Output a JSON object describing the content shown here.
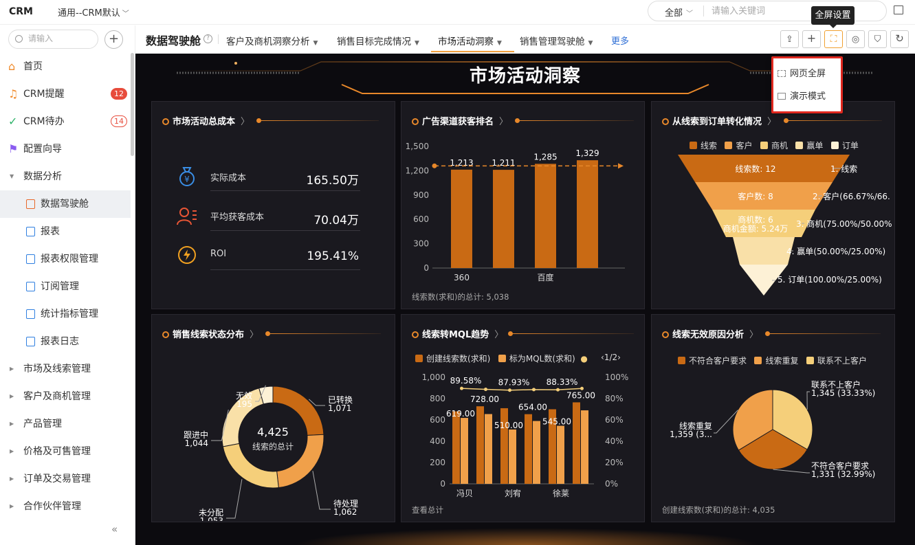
{
  "topbar": {
    "logo": "CRM",
    "app": "通用--CRM默认",
    "search_scope": "全部",
    "search_placeholder": "请输入关键词"
  },
  "sidebar": {
    "search_placeholder": "请输入",
    "items": [
      {
        "label": "首页",
        "icon": "home-icon"
      },
      {
        "label": "CRM提醒",
        "icon": "bell-icon",
        "badge": "12"
      },
      {
        "label": "CRM待办",
        "icon": "check-circle-icon",
        "badge": "14"
      },
      {
        "label": "配置向导",
        "icon": "flag-icon"
      },
      {
        "label": "数据分析",
        "icon": "caret-down-icon"
      },
      {
        "label": "数据驾驶舱",
        "icon": "cockpit-icon"
      },
      {
        "label": "报表",
        "icon": "report-icon"
      },
      {
        "label": "报表权限管理",
        "icon": "report-permission-icon"
      },
      {
        "label": "订阅管理",
        "icon": "subscribe-icon"
      },
      {
        "label": "统计指标管理",
        "icon": "metric-icon"
      },
      {
        "label": "报表日志",
        "icon": "log-icon"
      },
      {
        "label": "市场及线索管理",
        "icon": "caret-right-icon"
      },
      {
        "label": "客户及商机管理",
        "icon": "caret-right-icon"
      },
      {
        "label": "产品管理",
        "icon": "caret-right-icon"
      },
      {
        "label": "价格及可售管理",
        "icon": "caret-right-icon"
      },
      {
        "label": "订单及交易管理",
        "icon": "caret-right-icon"
      },
      {
        "label": "合作伙伴管理",
        "icon": "caret-right-icon"
      }
    ],
    "collapse": "«"
  },
  "tabbar": {
    "title": "数据驾驶舱",
    "tabs": [
      {
        "label": "客户及商机洞察分析"
      },
      {
        "label": "销售目标完成情况"
      },
      {
        "label": "市场活动洞察"
      },
      {
        "label": "销售管理驾驶舱"
      }
    ],
    "more": "更多",
    "tooltip": "全屏设置",
    "menu": [
      "网页全屏",
      "演示模式"
    ]
  },
  "dashboard": {
    "title": "市场活动洞察",
    "colors": {
      "c1": "#c96a14",
      "c2": "#f0a04a",
      "c3": "#f5cf7a",
      "c4": "#f9e0a8",
      "c5": "#fdf1d6"
    },
    "p1": {
      "title": "市场活动总成本",
      "kpis": [
        {
          "label": "实际成本",
          "value": "165.50万",
          "icon": "money-bag-icon"
        },
        {
          "label": "平均获客成本",
          "value": "70.04万",
          "icon": "user-list-icon"
        },
        {
          "label": "ROI",
          "value": "195.41%",
          "icon": "lightning-icon"
        }
      ]
    },
    "p2": {
      "title": "广告渠道获客排名",
      "footer": "线索数(求和)的总计: 5,038"
    },
    "p3": {
      "title": "从线索到订单转化情况",
      "legend": [
        "线索",
        "客户",
        "商机",
        "赢单",
        "订单"
      ],
      "inner": [
        "线索数: 12",
        "客户数: 8",
        "商机数: 6",
        "商机金额: 5.24万"
      ],
      "right": [
        "1. 线索",
        "2. 客户(66.67%/66.",
        "3. 商机(75.00%/50.00%",
        "4. 赢单(50.00%/25.00%)",
        "5. 订单(100.00%/25.00%)"
      ]
    },
    "p4": {
      "title": "销售线索状态分布",
      "total": "4,425",
      "total_label": "线索的总计"
    },
    "p5": {
      "title": "线索转MQL趋势",
      "legend": [
        "创建线索数(求和)",
        "标为MQL数(求和)"
      ],
      "pager": "1/2",
      "footer": "查看总计"
    },
    "p6": {
      "title": "线索无效原因分析",
      "legend": [
        "不符合客户要求",
        "线索重复",
        "联系不上客户"
      ],
      "footer": "创建线索数(求和)的总计: 4,035"
    }
  },
  "chart_data": [
    {
      "type": "bar",
      "title": "广告渠道获客排名",
      "categories": [
        "360",
        "",
        "百度",
        ""
      ],
      "values": [
        1213,
        1211,
        1285,
        1329
      ],
      "ylim": [
        0,
        1500
      ],
      "yticks": [
        0,
        300,
        600,
        900,
        1200,
        1500
      ],
      "reference_line": 1260
    },
    {
      "type": "funnel",
      "title": "从线索到订单转化情况",
      "categories": [
        "线索",
        "客户",
        "商机",
        "赢单",
        "订单"
      ]
    },
    {
      "type": "pie",
      "title": "销售线索状态分布",
      "series": [
        {
          "name": "已转换",
          "value": 1071,
          "label": "1,071"
        },
        {
          "name": "待处理",
          "value": 1062,
          "label": "1,062"
        },
        {
          "name": "未分配",
          "value": 1053,
          "label": "1,053"
        },
        {
          "name": "跟进中",
          "value": 1044,
          "label": "1,044"
        },
        {
          "name": "无效",
          "value": 195,
          "label": "195"
        }
      ]
    },
    {
      "type": "bar",
      "title": "线索转MQL趋势",
      "categories": [
        "冯贝",
        "",
        "刘宥",
        "",
        "徐莱",
        ""
      ],
      "series": [
        {
          "name": "创建线索数(求和)",
          "values": [
            680,
            728,
            710,
            654,
            700,
            765
          ]
        },
        {
          "name": "标为MQL数(求和)",
          "values": [
            619,
            655,
            510,
            590,
            545,
            690
          ]
        }
      ],
      "line": [
        89.58,
        88.7,
        87.93,
        88.5,
        88.33,
        89.5
      ],
      "data_labels": [
        "619.00",
        "728.00",
        "510.00",
        "654.00",
        "545.00",
        "765.00"
      ],
      "line_labels": [
        "89.58%",
        "87.93%",
        "88.33%"
      ],
      "ylim": [
        0,
        1000
      ],
      "yticks": [
        0,
        200,
        400,
        600,
        800,
        1000
      ],
      "y2ticks": [
        "0%",
        "20%",
        "40%",
        "60%",
        "80%",
        "100%"
      ]
    },
    {
      "type": "pie",
      "title": "线索无效原因分析",
      "series": [
        {
          "name": "联系不上客户",
          "value": 1345,
          "label": "1,345 (33.33%)"
        },
        {
          "name": "不符合客户要求",
          "value": 1331,
          "label": "1,331 (32.99%)"
        },
        {
          "name": "线索重复",
          "value": 1359,
          "label": "1,359 (3..."
        }
      ]
    }
  ]
}
